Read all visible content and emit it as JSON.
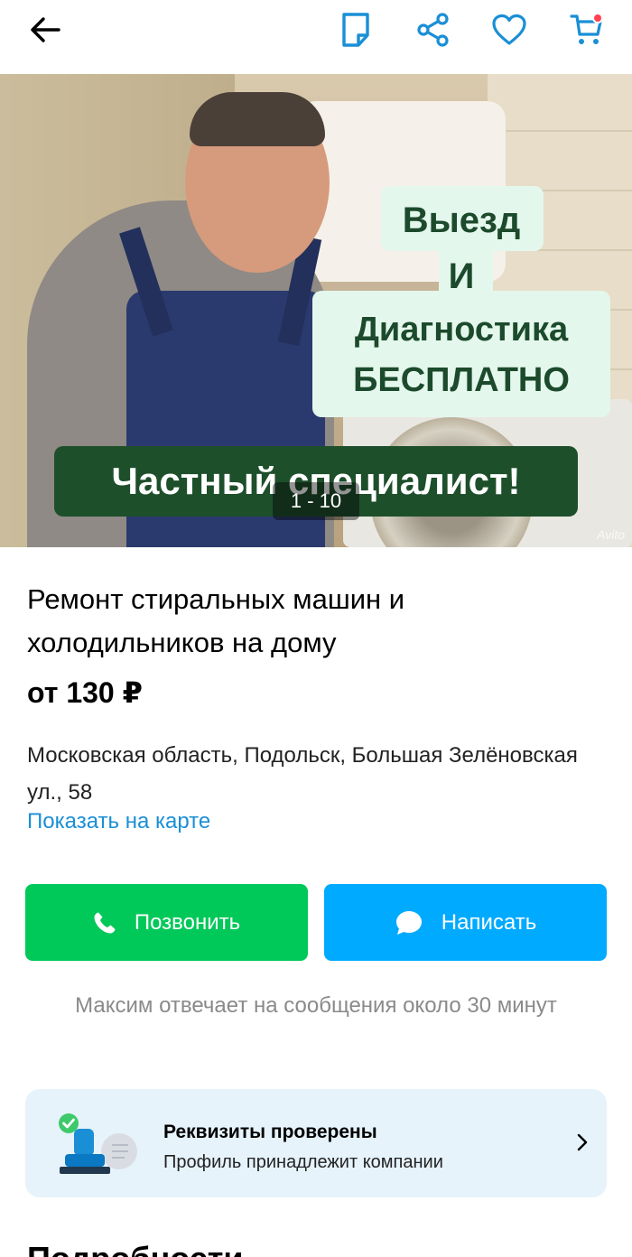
{
  "topbar": {
    "back_icon": "arrow-left-icon",
    "note_icon": "note-icon",
    "share_icon": "share-icon",
    "favorite_icon": "heart-icon",
    "cart_icon": "cart-icon",
    "accent": "#1a8fd6",
    "notification_dot_color": "#ff4053"
  },
  "gallery": {
    "promo_line1": "Выезд",
    "promo_line2": "И",
    "promo_line3": "Диагностика",
    "promo_line4": "БЕСПЛАТНО",
    "badge_text": "Частный специалист!",
    "counter": "1 - 10",
    "watermark": "Avito"
  },
  "listing": {
    "title": "Ремонт стиральных машин и холодильников на дому",
    "price": "от 130 ₽",
    "address": "Московская область, Подольск, Большая Зелёновская ул., 58",
    "map_link": "Показать на карте"
  },
  "actions": {
    "call_label": "Позвонить",
    "call_icon": "phone-icon",
    "call_color": "#00c859",
    "message_label": "Написать",
    "message_icon": "chat-bubble-icon",
    "message_color": "#00aaff"
  },
  "reply_info": "Максим отвечает на сообщения около 30 минут",
  "verification": {
    "title": "Реквизиты проверены",
    "subtitle": "Профиль принадлежит компании",
    "icon": "verified-stamp-icon"
  },
  "section_title": "Подробности"
}
